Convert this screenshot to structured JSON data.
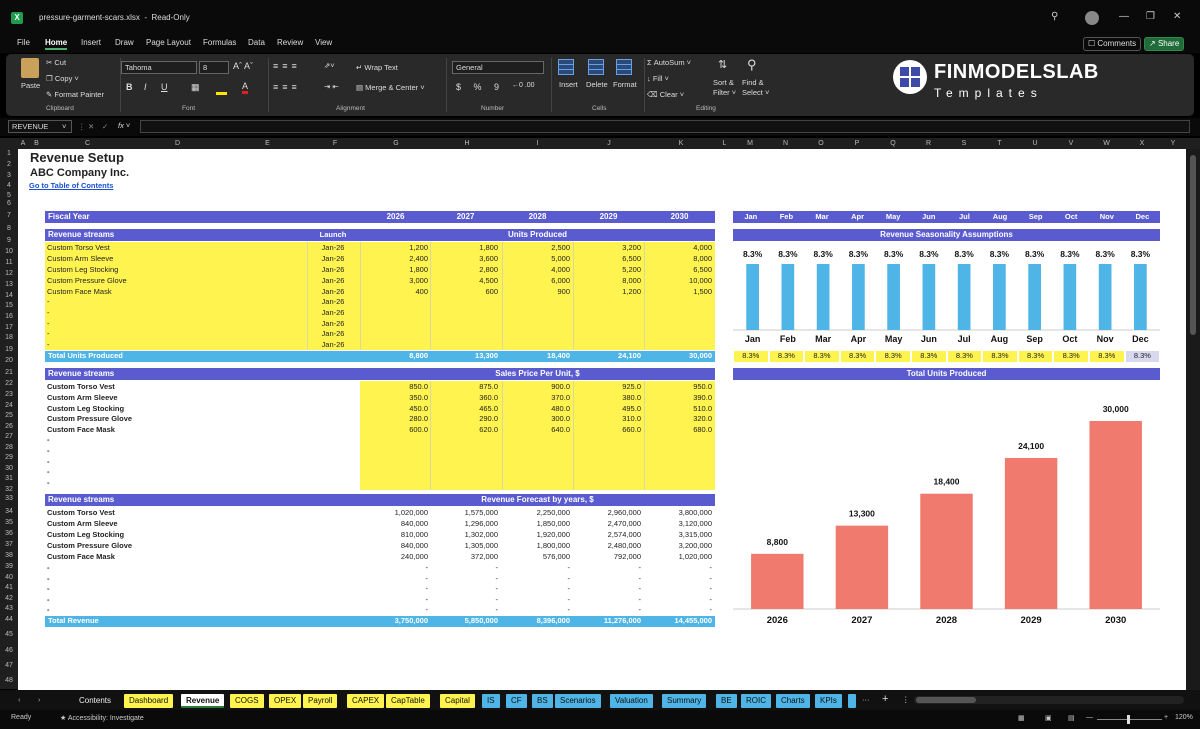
{
  "app": {
    "filename": "pressure-garment-scars.xlsx",
    "mode": "Read-Only"
  },
  "menu": [
    "File",
    "Home",
    "Insert",
    "Draw",
    "Page Layout",
    "Formulas",
    "Data",
    "Review",
    "View"
  ],
  "menu_right": {
    "comments": "Comments",
    "share": "Share"
  },
  "ribbon": {
    "paste": "Paste",
    "cut": "Cut",
    "copy": "Copy",
    "format_painter": "Format Painter",
    "clipboard": "Clipboard",
    "font_name": "Tahoma",
    "font_size": "8",
    "font_group": "Font",
    "wrap_text": "Wrap Text",
    "merge_center": "Merge & Center",
    "alignment": "Alignment",
    "number_format": "General",
    "number": "Number",
    "insert": "Insert",
    "delete": "Delete",
    "format": "Format",
    "cells": "Cells",
    "autosum": "AutoSum",
    "fill": "Fill",
    "clear": "Clear",
    "sort_filter": "Sort &",
    "sort_filter2": "Filter",
    "find_select": "Find &",
    "find_select2": "Select",
    "editing": "Editing",
    "brand": "FINMODELSLAB",
    "brand_sub": "Templates"
  },
  "name_box": "REVENUE",
  "columns": [
    "A",
    "B",
    "C",
    "D",
    "E",
    "F",
    "G",
    "H",
    "I",
    "J",
    "K",
    "L",
    "M",
    "N",
    "O",
    "P",
    "Q",
    "R",
    "S",
    "T",
    "U",
    "V",
    "W",
    "X",
    "Y"
  ],
  "rows": [
    "1",
    "2",
    "3",
    "4",
    "5",
    "6",
    "7",
    "8",
    "9",
    "10",
    "11",
    "12",
    "13",
    "14",
    "15",
    "16",
    "17",
    "18",
    "19",
    "20",
    "21",
    "22",
    "23",
    "24",
    "25",
    "26",
    "27",
    "28",
    "29",
    "30",
    "31",
    "32",
    "33",
    "34",
    "35",
    "36",
    "37",
    "38",
    "39",
    "40",
    "41",
    "42",
    "43",
    "44",
    "45",
    "46",
    "47",
    "48"
  ],
  "sheet": {
    "title": "Revenue Setup",
    "company": "ABC Company Inc.",
    "toc": "Go to Table of Contents",
    "fiscal_year": "Fiscal Year",
    "years": [
      "2026",
      "2027",
      "2028",
      "2029",
      "2030"
    ],
    "months": [
      "Jan",
      "Feb",
      "Mar",
      "Apr",
      "May",
      "Jun",
      "Jul",
      "Aug",
      "Sep",
      "Oct",
      "Nov",
      "Dec"
    ],
    "revenue_streams": "Revenue streams",
    "launch": "Launch",
    "units_header": "Units Produced",
    "units_rows": [
      {
        "name": "Custom Torso Vest",
        "launch": "Jan-26",
        "v": [
          "1,200",
          "1,800",
          "2,500",
          "3,200",
          "4,000"
        ]
      },
      {
        "name": "Custom Arm Sleeve",
        "launch": "Jan-26",
        "v": [
          "2,400",
          "3,600",
          "5,000",
          "6,500",
          "8,000"
        ]
      },
      {
        "name": "Custom Leg Stocking",
        "launch": "Jan-26",
        "v": [
          "1,800",
          "2,800",
          "4,000",
          "5,200",
          "6,500"
        ]
      },
      {
        "name": "Custom Pressure Glove",
        "launch": "Jan-26",
        "v": [
          "3,000",
          "4,500",
          "6,000",
          "8,000",
          "10,000"
        ]
      },
      {
        "name": "Custom Face Mask",
        "launch": "Jan-26",
        "v": [
          "400",
          "600",
          "900",
          "1,200",
          "1,500"
        ]
      },
      {
        "name": "-",
        "launch": "Jan-26",
        "v": [
          "",
          "",
          "",
          "",
          ""
        ]
      },
      {
        "name": "-",
        "launch": "Jan-26",
        "v": [
          "",
          "",
          "",
          "",
          ""
        ]
      },
      {
        "name": "-",
        "launch": "Jan-26",
        "v": [
          "",
          "",
          "",
          "",
          ""
        ]
      },
      {
        "name": "-",
        "launch": "Jan-26",
        "v": [
          "",
          "",
          "",
          "",
          ""
        ]
      },
      {
        "name": "-",
        "launch": "Jan-26",
        "v": [
          "",
          "",
          "",
          "",
          ""
        ]
      }
    ],
    "total_units_label": "Total Units Produced",
    "total_units": [
      "8,800",
      "13,300",
      "18,400",
      "24,100",
      "30,000"
    ],
    "price_header": "Sales Price Per Unit, $",
    "price_rows": [
      {
        "name": "Custom Torso Vest",
        "v": [
          "850.0",
          "875.0",
          "900.0",
          "925.0",
          "950.0"
        ]
      },
      {
        "name": "Custom Arm Sleeve",
        "v": [
          "350.0",
          "360.0",
          "370.0",
          "380.0",
          "390.0"
        ]
      },
      {
        "name": "Custom Leg Stocking",
        "v": [
          "450.0",
          "465.0",
          "480.0",
          "495.0",
          "510.0"
        ]
      },
      {
        "name": "Custom Pressure Glove",
        "v": [
          "280.0",
          "290.0",
          "300.0",
          "310.0",
          "320.0"
        ]
      },
      {
        "name": "Custom Face Mask",
        "v": [
          "600.0",
          "620.0",
          "640.0",
          "660.0",
          "680.0"
        ]
      },
      {
        "name": "-",
        "v": [
          "",
          "",
          "",
          "",
          ""
        ]
      },
      {
        "name": "-",
        "v": [
          "",
          "",
          "",
          "",
          ""
        ]
      },
      {
        "name": "-",
        "v": [
          "",
          "",
          "",
          "",
          ""
        ]
      },
      {
        "name": "-",
        "v": [
          "",
          "",
          "",
          "",
          ""
        ]
      },
      {
        "name": "-",
        "v": [
          "",
          "",
          "",
          "",
          ""
        ]
      }
    ],
    "forecast_header": "Revenue Forecast by years, $",
    "forecast_rows": [
      {
        "name": "Custom Torso Vest",
        "v": [
          "1,020,000",
          "1,575,000",
          "2,250,000",
          "2,960,000",
          "3,800,000"
        ]
      },
      {
        "name": "Custom Arm Sleeve",
        "v": [
          "840,000",
          "1,296,000",
          "1,850,000",
          "2,470,000",
          "3,120,000"
        ]
      },
      {
        "name": "Custom Leg Stocking",
        "v": [
          "810,000",
          "1,302,000",
          "1,920,000",
          "2,574,000",
          "3,315,000"
        ]
      },
      {
        "name": "Custom Pressure Glove",
        "v": [
          "840,000",
          "1,305,000",
          "1,800,000",
          "2,480,000",
          "3,200,000"
        ]
      },
      {
        "name": "Custom Face Mask",
        "v": [
          "240,000",
          "372,000",
          "576,000",
          "792,000",
          "1,020,000"
        ]
      },
      {
        "name": "-",
        "v": [
          "-",
          "-",
          "-",
          "-",
          "-"
        ]
      },
      {
        "name": "-",
        "v": [
          "-",
          "-",
          "-",
          "-",
          "-"
        ]
      },
      {
        "name": "-",
        "v": [
          "-",
          "-",
          "-",
          "-",
          "-"
        ]
      },
      {
        "name": "-",
        "v": [
          "-",
          "-",
          "-",
          "-",
          "-"
        ]
      },
      {
        "name": "-",
        "v": [
          "-",
          "-",
          "-",
          "-",
          "-"
        ]
      }
    ],
    "total_revenue_label": "Total Revenue",
    "total_revenue": [
      "3,750,000",
      "5,850,000",
      "8,396,000",
      "11,276,000",
      "14,455,000"
    ],
    "seasonality_row": [
      "8.3%",
      "8.3%",
      "8.3%",
      "8.3%",
      "8.3%",
      "8.3%",
      "8.3%",
      "8.3%",
      "8.3%",
      "8.3%",
      "8.3%",
      "8.3%"
    ]
  },
  "chart_data": [
    {
      "type": "bar",
      "title": "Revenue Seasonality Assumptions",
      "categories": [
        "Jan",
        "Feb",
        "Mar",
        "Apr",
        "May",
        "Jun",
        "Jul",
        "Aug",
        "Sep",
        "Oct",
        "Nov",
        "Dec"
      ],
      "values": [
        8.3,
        8.3,
        8.3,
        8.3,
        8.3,
        8.3,
        8.3,
        8.3,
        8.3,
        8.3,
        8.3,
        8.3
      ],
      "labels": [
        "8.3%",
        "8.3%",
        "8.3%",
        "8.3%",
        "8.3%",
        "8.3%",
        "8.3%",
        "8.3%",
        "8.3%",
        "8.3%",
        "8.3%",
        "8.3%"
      ],
      "ylim": [
        0,
        8.3
      ],
      "color": "#4fb4e6"
    },
    {
      "type": "bar",
      "title": "Total Units Produced",
      "categories": [
        "2026",
        "2027",
        "2028",
        "2029",
        "2030"
      ],
      "values": [
        8800,
        13300,
        18400,
        24100,
        30000
      ],
      "labels": [
        "8,800",
        "13,300",
        "18,400",
        "24,100",
        "30,000"
      ],
      "ylim": [
        0,
        30000
      ],
      "color": "#f07a6e"
    }
  ],
  "tabs": [
    "Contents",
    "Dashboard",
    "Revenue",
    "COGS",
    "OPEX",
    "Payroll",
    "CAPEX",
    "CapTable",
    "Capital",
    "IS",
    "CF",
    "BS",
    "Scenarios",
    "Valuation",
    "Summary",
    "BE",
    "ROIC",
    "Charts",
    "KPIs"
  ],
  "tab_colors": {
    "yellow": "#fff44f",
    "blue": "#4fb4e6",
    "active": "#ffffff"
  },
  "status": {
    "ready": "Ready",
    "accessibility": "Accessibility: Investigate",
    "zoom": "120%"
  }
}
